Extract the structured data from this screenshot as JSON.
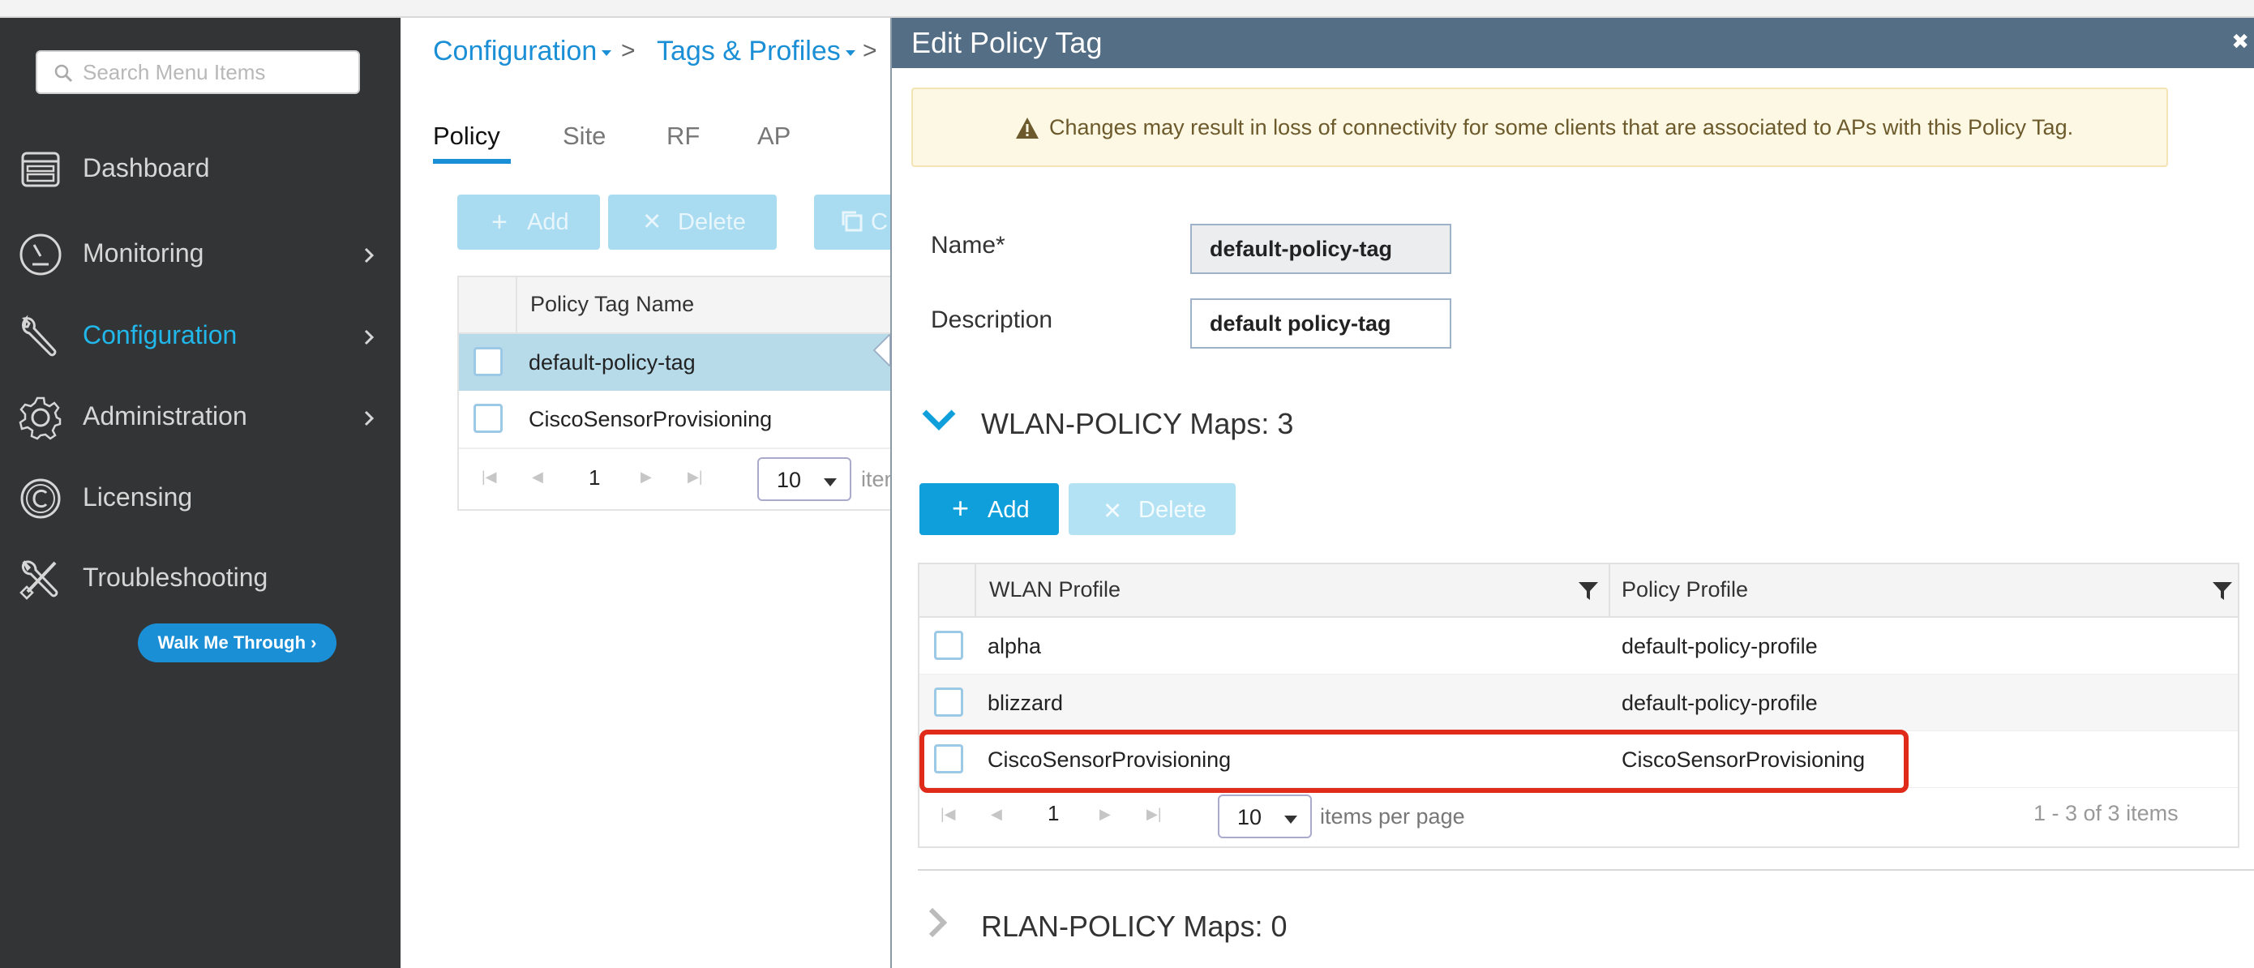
{
  "sidebar": {
    "search_placeholder": "Search Menu Items",
    "items": [
      {
        "label": "Dashboard"
      },
      {
        "label": "Monitoring"
      },
      {
        "label": "Configuration"
      },
      {
        "label": "Administration"
      },
      {
        "label": "Licensing"
      },
      {
        "label": "Troubleshooting"
      }
    ],
    "walk_me_through": "Walk Me Through ›"
  },
  "breadcrumb": {
    "configuration": "Configuration",
    "tags_profiles": "Tags & Profiles",
    "separator": ">"
  },
  "tabs": [
    "Policy",
    "Site",
    "RF",
    "AP"
  ],
  "toolbar": {
    "add": "Add",
    "delete": "Delete",
    "clone": "C"
  },
  "tag_table": {
    "header": "Policy Tag Name",
    "rows": [
      "default-policy-tag",
      "CiscoSensorProvisioning"
    ],
    "page": "1",
    "page_size": "10",
    "items_per_page_partial": "iten"
  },
  "modal": {
    "title": "Edit Policy Tag",
    "close": "✖",
    "alert": "Changes may result in loss of connectivity for some clients that are associated to APs with this Policy Tag.",
    "name_label": "Name*",
    "name_value": "default-policy-tag",
    "description_label": "Description",
    "description_value": "default policy-tag",
    "wlan_section": "WLAN-POLICY Maps: 3",
    "add": "Add",
    "delete": "Delete",
    "table": {
      "col_wlan": "WLAN Profile",
      "col_policy": "Policy Profile",
      "rows": [
        {
          "wlan": "alpha",
          "policy": "default-policy-profile"
        },
        {
          "wlan": "blizzard",
          "policy": "default-policy-profile"
        },
        {
          "wlan": "CiscoSensorProvisioning",
          "policy": "CiscoSensorProvisioning"
        }
      ],
      "page": "1",
      "page_size": "10",
      "items_per_page": "items per page",
      "count": "1 - 3 of 3 items"
    },
    "rlan_section": "RLAN-POLICY Maps: 0"
  },
  "colors": {
    "sidebar_bg": "#333435",
    "accent_blue": "#1a8fd6",
    "active_menu": "#21b7ea",
    "modal_header": "#546e85",
    "highlight_red": "#e02b1a"
  }
}
